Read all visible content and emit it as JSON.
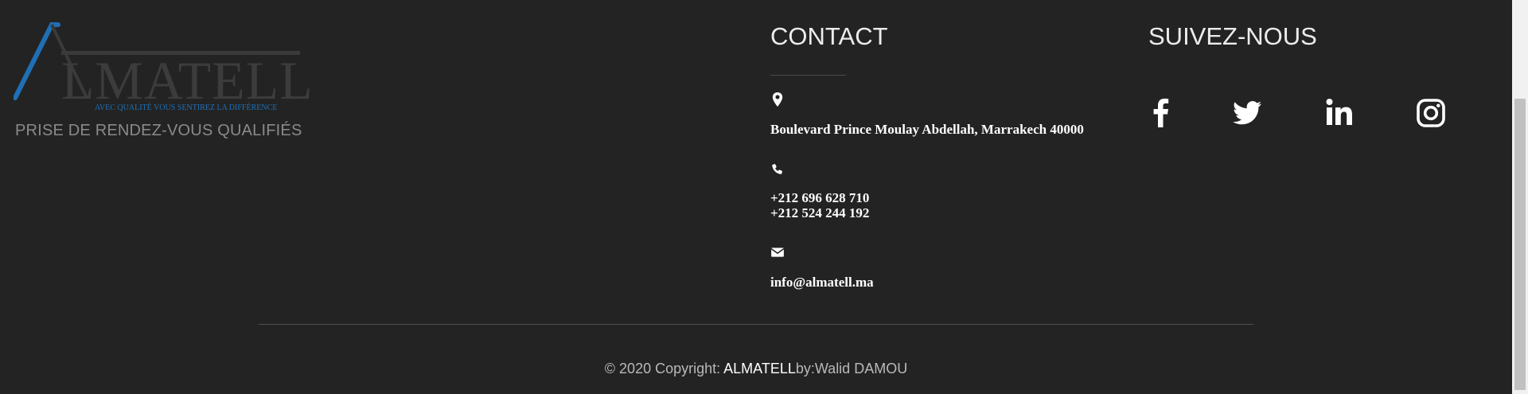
{
  "logo": {
    "wordmark": "LMATELL",
    "slogan": "AVEC QUALITÉ VOUS SENTIREZ LA DIFFÉRENCE",
    "brand_color": "#1f6fb5"
  },
  "tagline": "PRISE DE RENDEZ-VOUS QUALIFIÉS",
  "contact": {
    "title": "CONTACT",
    "address_icon": "map-marker-icon",
    "address": "Boulevard Prince Moulay Abdellah, Marrakech 40000",
    "phone_icon": "phone-icon",
    "phone_1": "+212 696 628 710",
    "phone_2": "+212 524 244 192",
    "email_icon": "envelope-icon",
    "email": "info@almatell.ma"
  },
  "follow": {
    "title": "SUIVEZ-NOUS",
    "networks": [
      "facebook-icon",
      "twitter-icon",
      "linkedin-icon",
      "instagram-icon"
    ]
  },
  "footer": {
    "prefix": "© 2020 Copyright: ",
    "brand": "ALMATELL",
    "suffix": "by:Walid DAMOU"
  }
}
